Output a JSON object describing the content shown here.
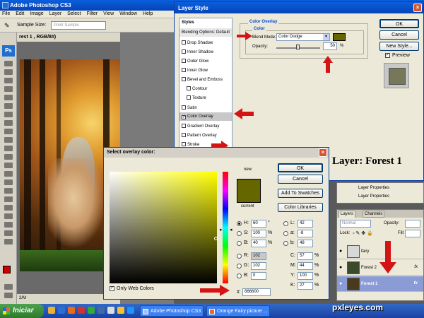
{
  "app": {
    "title": "Adobe Photoshop CS3",
    "menu": [
      "File",
      "Edit",
      "Image",
      "Layer",
      "Select",
      "Filter",
      "View",
      "Window",
      "Help"
    ],
    "options": {
      "sample_size_label": "Sample Size:",
      "sample_size_value": "Point Sample"
    },
    "logo_text": "Ps"
  },
  "document": {
    "title": "rest 1 , RGB/8#)",
    "zoom": "2/M"
  },
  "layer_style": {
    "title": "Layer Style",
    "styles_header": "Styles",
    "items": [
      {
        "label": "Blending Options: Default",
        "checked": null
      },
      {
        "label": "Drop Shadow",
        "checked": false
      },
      {
        "label": "Inner Shadow",
        "checked": false
      },
      {
        "label": "Outer Glow",
        "checked": false
      },
      {
        "label": "Inner Glow",
        "checked": false
      },
      {
        "label": "Bevel and Emboss",
        "checked": false
      },
      {
        "label": "Contour",
        "checked": false
      },
      {
        "label": "Texture",
        "checked": false
      },
      {
        "label": "Satin",
        "checked": false
      },
      {
        "label": "Color Overlay",
        "checked": true
      },
      {
        "label": "Gradient Overlay",
        "checked": false
      },
      {
        "label": "Pattern Overlay",
        "checked": false
      },
      {
        "label": "Stroke",
        "checked": false
      }
    ],
    "section_title": "Color Overlay",
    "group_title": "Color",
    "blend_mode_label": "Blend Mode:",
    "blend_mode_value": "Color Dodge",
    "opacity_label": "Opacity:",
    "opacity_value": "50",
    "opacity_unit": "%",
    "ok": "OK",
    "cancel": "Cancel",
    "new_style": "New Style...",
    "preview_label": "Preview",
    "preview_checked": true,
    "overlay_color": "#666600"
  },
  "caption": "Layer: Forest 1",
  "color_picker": {
    "title": "Select overlay color:",
    "ok": "OK",
    "cancel": "Cancel",
    "add_swatches": "Add To Swatches",
    "color_libraries": "Color Libraries",
    "new_label": "new",
    "current_label": "current",
    "only_web": "Only Web Colors",
    "fields": {
      "H": {
        "value": "60",
        "unit": "°"
      },
      "S": {
        "value": "100",
        "unit": "%"
      },
      "B": {
        "value": "40",
        "unit": "%"
      },
      "R": {
        "value": "102"
      },
      "G": {
        "value": "102"
      },
      "Bb": {
        "value": "0"
      },
      "L": {
        "value": "42"
      },
      "a": {
        "value": "-8"
      },
      "b": {
        "value": "48"
      },
      "C": {
        "value": "57",
        "unit": "%"
      },
      "M": {
        "value": "44",
        "unit": "%"
      },
      "Y": {
        "value": "100",
        "unit": "%"
      },
      "K": {
        "value": "27",
        "unit": "%"
      }
    },
    "hex": "666600"
  },
  "layers_panel": {
    "tabs": [
      "Layers",
      "Channels"
    ],
    "blend": "Normal",
    "opacity_label": "Opacity:",
    "lock_label": "Lock:",
    "fill_label": "Fill:",
    "props": [
      "Layer Properties",
      "Layer Properties"
    ],
    "layers": [
      {
        "name": "fairy",
        "fx": ""
      },
      {
        "name": "Forest 2",
        "fx": "fx"
      },
      {
        "name": "Forest 1",
        "fx": "fx"
      }
    ]
  },
  "taskbar": {
    "start": "Iniciar",
    "items": [
      "Adobe Photoshop CS3",
      "Orange Fairy picture ..."
    ]
  },
  "watermark": {
    "main": "pxleyes",
    "dot": ".",
    "tld": "com"
  },
  "colors": {
    "accent_red": "#d41414",
    "xp_blue": "#0a5fdc"
  }
}
